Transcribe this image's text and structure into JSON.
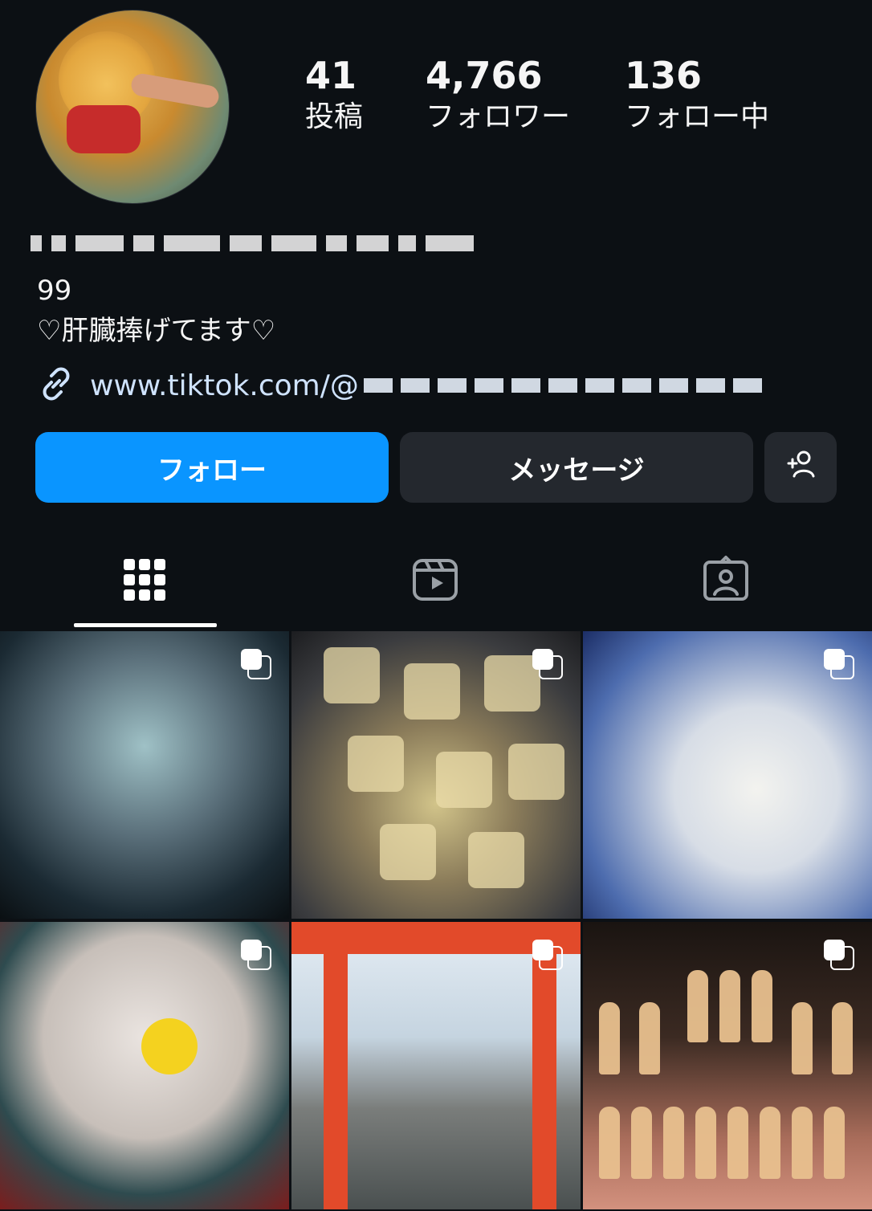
{
  "profile": {
    "stats": [
      {
        "value": "41",
        "label": "投稿"
      },
      {
        "value": "4,766",
        "label": "フォロワー"
      },
      {
        "value": "136",
        "label": "フォロー中"
      }
    ],
    "bio_lines": [
      "99",
      "♡肝臓捧げてます♡"
    ],
    "link_text": "www.tiktok.com/@"
  },
  "buttons": {
    "follow": "フォロー",
    "message": "メッセージ"
  },
  "tabs": [
    "grid-tab",
    "reels-tab",
    "tagged-tab"
  ],
  "colors": {
    "follow_blue": "#0a95ff",
    "background": "#0c1014"
  }
}
